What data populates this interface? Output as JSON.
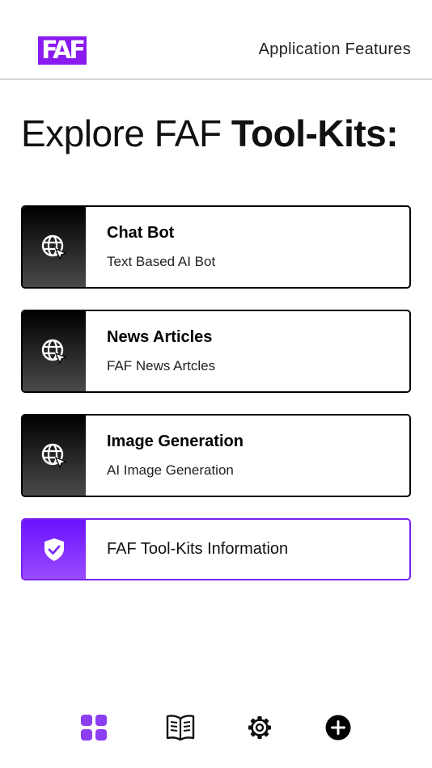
{
  "header": {
    "logo_text": "FAF",
    "link_label": "Application Features"
  },
  "page": {
    "title_light": "Explore FAF ",
    "title_bold": "Tool-Kits:"
  },
  "cards": [
    {
      "title": "Chat Bot",
      "subtitle": "Text Based AI Bot",
      "icon": "globe-cursor-icon"
    },
    {
      "title": "News Articles",
      "subtitle": "FAF News Artcles",
      "icon": "globe-cursor-icon"
    },
    {
      "title": "Image Generation",
      "subtitle": "AI Image Generation",
      "icon": "globe-cursor-icon"
    }
  ],
  "info_card": {
    "title": "FAF Tool-Kits Information",
    "icon": "shield-check-icon"
  },
  "bottom_nav": [
    {
      "name": "dashboard",
      "icon": "grid-icon",
      "active": true
    },
    {
      "name": "articles",
      "icon": "book-icon",
      "active": false
    },
    {
      "name": "settings",
      "icon": "gear-icon",
      "active": false
    },
    {
      "name": "add",
      "icon": "plus-circle-icon",
      "active": false
    }
  ],
  "colors": {
    "accent": "#8a1bf0",
    "nav_active": "#8b3ff0",
    "text": "#111111"
  }
}
